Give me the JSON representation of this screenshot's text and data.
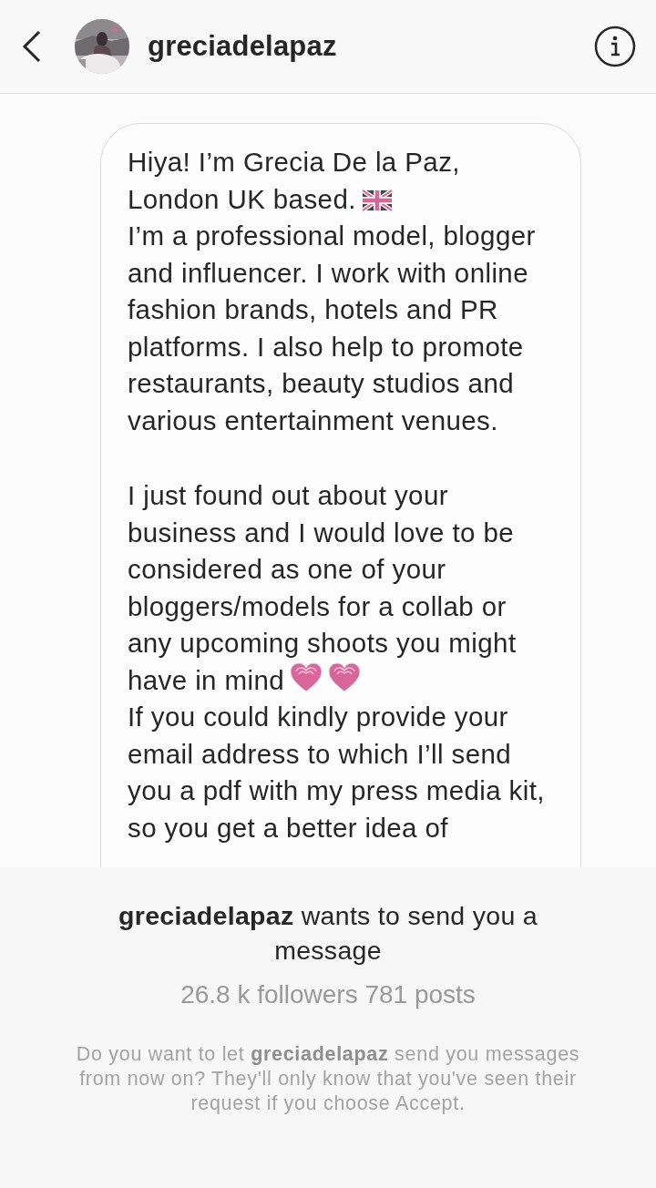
{
  "header": {
    "username": "greciadelapaz"
  },
  "message": {
    "blocks": [
      [
        {
          "text": "Hiya! I’m Grecia De la Paz, London UK based.",
          "end_icons": [
            {
              "kind": "flag"
            }
          ]
        },
        {
          "text": "I’m a professional model, blogger and influencer. I work with online fashion brands, hotels and PR platforms. I also help to promote restaurants, beauty studios and various entertainment venues."
        }
      ],
      [
        {
          "text": "I just found out about your business and I would love to be considered as one of your bloggers/models for a collab or any upcoming shoots you might have in mind",
          "end_icons": [
            {
              "kind": "heart"
            },
            {
              "kind": "heart"
            }
          ]
        },
        {
          "text": "If you could kindly provide your email address to which I’ll send you a pdf with my press media kit, so you get a better idea of"
        }
      ]
    ]
  },
  "request": {
    "title": "**greciadelapaz** wants to send you a message",
    "stats": "26.8 k followers 781 posts",
    "notice": "Do you want to let **greciadelapaz** send you messages from now on? They'll only know that you've seen their request if you choose Accept."
  }
}
